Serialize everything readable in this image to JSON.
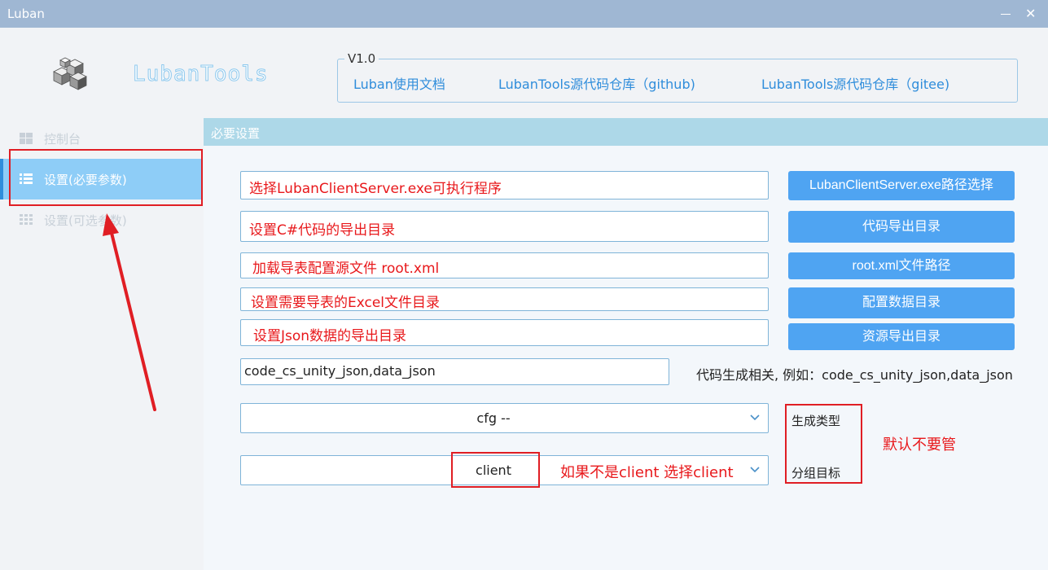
{
  "window": {
    "title": "Luban",
    "close_glyph": "✕"
  },
  "brand": {
    "name": "LubanTools",
    "logo_icon": "cube-cluster-logo"
  },
  "links": {
    "version": "V1.0",
    "items": [
      "Luban使用文档",
      "LubanTools源代码仓库（github)",
      "LubanTools源代码仓库（gitee)"
    ]
  },
  "sidebar": {
    "items": [
      {
        "label": "控制台",
        "icon": "windows-icon"
      },
      {
        "label": "设置(必要参数)",
        "icon": "list-icon"
      },
      {
        "label": "设置(可选参数)",
        "icon": "grid-icon"
      }
    ]
  },
  "panel": {
    "header": "必要设置",
    "fields": [
      "选择LubanClientServer.exe可执行程序",
      "设置C#代码的导出目录",
      "加载导表配置源文件 root.xml",
      "设置需要导表的Excel文件目录",
      "设置Json数据的导出目录"
    ],
    "buttons": [
      "LubanClientServer.exe路径选择",
      "代码导出目录",
      "root.xml文件路径",
      "配置数据目录",
      "资源导出目录"
    ],
    "gen_field": "code_cs_unity_json,data_json",
    "gen_note": "代码生成相关, 例如：code_cs_unity_json,data_json",
    "gen_type": {
      "value": "cfg --",
      "label": "生成类型"
    },
    "group": {
      "value": "client",
      "label": "分组目标"
    }
  },
  "annotations": {
    "client_hint": "如果不是client 选择client",
    "default_hint": "默认不要管"
  },
  "colors": {
    "accent": "#4fa4f2",
    "active_nav": "#8ecdf7",
    "annotation": "#e01e24"
  }
}
